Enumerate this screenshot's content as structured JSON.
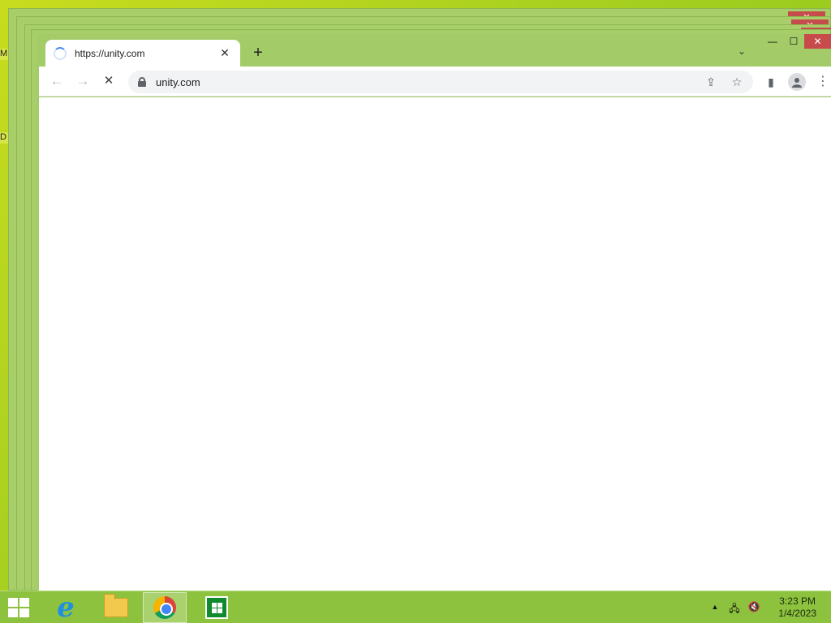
{
  "desktop": {
    "edge_letters": [
      "M",
      "D"
    ]
  },
  "stack_windows": {
    "close_glyph": "✕",
    "minimize_glyph": "—",
    "maximize_glyph": "☐"
  },
  "browser": {
    "tab": {
      "title": "https://unity.com",
      "close_glyph": "✕"
    },
    "new_tab_glyph": "+",
    "tab_search_glyph": "⌄",
    "window_controls": {
      "minimize": "—",
      "maximize": "☐",
      "close": "✕"
    },
    "toolbar": {
      "back_glyph": "←",
      "forward_glyph": "→",
      "stop_glyph": "✕",
      "url": "unity.com",
      "share_glyph": "⇪",
      "bookmark_glyph": "☆",
      "side_panel_glyph": "▮",
      "menu_glyph": "⋮"
    },
    "theme_color": "#a3cb68"
  },
  "taskbar": {
    "apps": [
      {
        "name": "Internet Explorer",
        "icon": "ie-icon"
      },
      {
        "name": "File Explorer",
        "icon": "folder-icon"
      },
      {
        "name": "Google Chrome",
        "icon": "chrome-icon",
        "active": true
      },
      {
        "name": "Store",
        "icon": "store-icon"
      }
    ],
    "tray": {
      "overflow_glyph": "▲",
      "network_glyph": "🖧",
      "volume_glyph": "🔇"
    },
    "clock": {
      "time": "3:23 PM",
      "date": "1/4/2023"
    }
  }
}
